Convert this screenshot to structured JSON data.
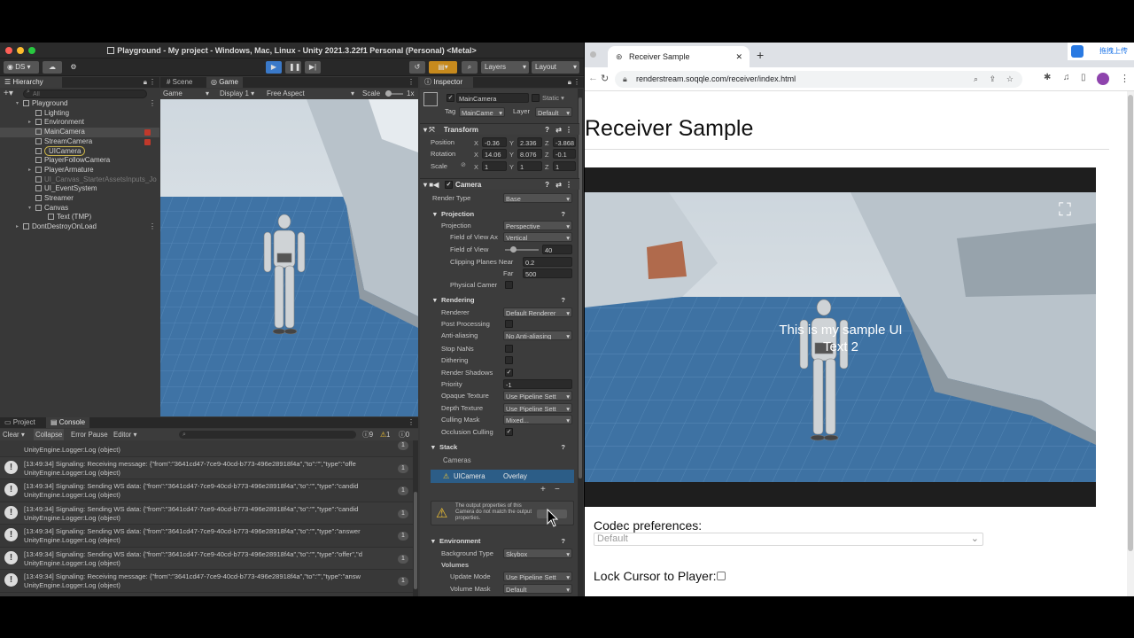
{
  "unity": {
    "title": "Playground - My project - Windows, Mac, Linux - Unity 2021.3.22f1 Personal (Personal) <Metal>",
    "account": "DS",
    "layers_label": "Layers",
    "layout_label": "Layout",
    "hierarchy": {
      "tab": "Hierarchy",
      "search_placeholder": "All",
      "items": [
        {
          "label": "Playground",
          "indent": 0
        },
        {
          "label": "Lighting",
          "indent": 1
        },
        {
          "label": "Environment",
          "indent": 1
        },
        {
          "label": "MainCamera",
          "indent": 1
        },
        {
          "label": "StreamCamera",
          "indent": 1
        },
        {
          "label": "UICamera",
          "indent": 1
        },
        {
          "label": "PlayerFollowCamera",
          "indent": 1
        },
        {
          "label": "PlayerArmature",
          "indent": 1
        },
        {
          "label": "UI_Canvas_StarterAssetsInputs_Jo",
          "indent": 1
        },
        {
          "label": "UI_EventSystem",
          "indent": 1
        },
        {
          "label": "Streamer",
          "indent": 1
        },
        {
          "label": "Canvas",
          "indent": 1
        },
        {
          "label": "Text (TMP)",
          "indent": 2
        },
        {
          "label": "DontDestroyOnLoad",
          "indent": 0
        }
      ]
    },
    "game": {
      "tab_scene": "Scene",
      "tab_game": "Game",
      "display_mode": "Game",
      "display": "Display 1",
      "aspect": "Free Aspect",
      "scale_label": "Scale",
      "scale_value": "1x"
    },
    "inspector": {
      "tab": "Inspector",
      "object_name": "MainCamera",
      "static_label": "Static",
      "tag_label": "Tag",
      "tag_value": "MainCame",
      "layer_label": "Layer",
      "layer_value": "Default",
      "transform": {
        "header": "Transform",
        "position_label": "Position",
        "position": [
          "-0.36",
          "2.336",
          "-3.868"
        ],
        "rotation_label": "Rotation",
        "rotation": [
          "14.06",
          "8.076",
          "-0.1"
        ],
        "scale_label": "Scale",
        "scale": [
          "1",
          "1",
          "1"
        ],
        "axes": [
          "X",
          "Y",
          "Z"
        ]
      },
      "camera": {
        "header": "Camera",
        "render_type_label": "Render Type",
        "render_type": "Base",
        "projection_header": "Projection",
        "projection_label": "Projection",
        "projection": "Perspective",
        "fov_axis_label": "Field of View Ax",
        "fov_axis": "Vertical",
        "fov_label": "Field of View",
        "fov": "40",
        "clip_label": "Clipping Planes Near",
        "clip_near": "0.2",
        "far_label": "Far",
        "clip_far": "500",
        "physical_label": "Physical Camer",
        "rendering_header": "Rendering",
        "renderer_label": "Renderer",
        "renderer": "Default Renderer",
        "post_label": "Post Processing",
        "aa_label": "Anti-aliasing",
        "aa": "No Anti-aliasing",
        "stopnans_label": "Stop NaNs",
        "dither_label": "Dithering",
        "shadows_label": "Render Shadows",
        "priority_label": "Priority",
        "priority": "-1",
        "opaque_label": "Opaque Texture",
        "opaque": "Use Pipeline Sett",
        "depth_label": "Depth Texture",
        "depth": "Use Pipeline Sett",
        "culling_label": "Culling Mask",
        "culling": "Mixed...",
        "occlusion_label": "Occlusion Culling",
        "stack_header": "Stack",
        "cameras_label": "Cameras",
        "stack_item_name": "UICamera",
        "stack_item_type": "Overlay",
        "warning": "The output properties of this Camera do not match the output properties.",
        "env_header": "Environment",
        "bg_label": "Background Type",
        "bg": "Skybox",
        "volumes_header": "Volumes",
        "update_label": "Update Mode",
        "update": "Use Pipeline Sett",
        "volmask_label": "Volume Mask",
        "volmask": "Default"
      }
    },
    "console": {
      "tab_project": "Project",
      "tab_console": "Console",
      "clear": "Clear",
      "collapse": "Collapse",
      "error_pause": "Error Pause",
      "editor": "Editor",
      "count_info": "9",
      "count_warn": "1",
      "count_err": "0",
      "rows": [
        {
          "l1": "",
          "l2": "UnityEngine.Logger:Log (object)",
          "count": "1"
        },
        {
          "l1": "[13:49:34] Signaling: Receiving message: {\"from\":\"3641cd47-7ce9-40cd-b773-496e28918f4a\",\"to\":\"\",\"type\":\"offe",
          "l2": "UnityEngine.Logger:Log (object)",
          "count": "1"
        },
        {
          "l1": "[13:49:34] Signaling: Sending WS data: {\"from\":\"3641cd47-7ce9-40cd-b773-496e28918f4a\",\"to\":\"\",\"type\":\"candid",
          "l2": "UnityEngine.Logger:Log (object)",
          "count": "1"
        },
        {
          "l1": "[13:49:34] Signaling: Sending WS data: {\"from\":\"3641cd47-7ce9-40cd-b773-496e28918f4a\",\"to\":\"\",\"type\":\"candid",
          "l2": "UnityEngine.Logger:Log (object)",
          "count": "1"
        },
        {
          "l1": "[13:49:34] Signaling: Sending WS data: {\"from\":\"3641cd47-7ce9-40cd-b773-496e28918f4a\",\"to\":\"\",\"type\":\"answer",
          "l2": "UnityEngine.Logger:Log (object)",
          "count": "1"
        },
        {
          "l1": "[13:49:34] Signaling: Sending WS data: {\"from\":\"3641cd47-7ce9-40cd-b773-496e28918f4a\",\"to\":\"\",\"type\":\"offer\",\"d",
          "l2": "UnityEngine.Logger:Log (object)",
          "count": "1"
        },
        {
          "l1": "[13:49:34] Signaling: Receiving message: {\"from\":\"3641cd47-7ce9-40cd-b773-496e28918f4a\",\"to\":\"\",\"type\":\"answ",
          "l2": "UnityEngine.Logger:Log (object)",
          "count": "1"
        }
      ]
    }
  },
  "browser": {
    "tab_title": "Receiver Sample",
    "new_tab": "+",
    "url": "renderstream.soqqle.com/receiver/index.html",
    "extension_label": "拖拽上传",
    "page": {
      "heading": "Receiver Sample",
      "overlay_line1": "This is my sample UI",
      "overlay_line2": "Text 2",
      "codec_label": "Codec preferences:",
      "codec_value": "Default",
      "lock_label": "Lock Cursor to Player:"
    }
  }
}
